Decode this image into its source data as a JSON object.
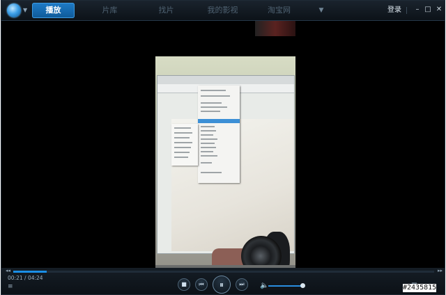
{
  "topbar": {
    "tabs": [
      {
        "label": "播放",
        "active": true
      },
      {
        "label": "片库",
        "active": false
      },
      {
        "label": "找片",
        "active": false
      },
      {
        "label": "我的影视",
        "active": false
      },
      {
        "label": "淘宝网",
        "active": false
      }
    ],
    "more_icon": "chevron-down-icon",
    "login_label": "登录",
    "window_buttons": {
      "minimize": "–",
      "maximize": "□",
      "close": "✕"
    }
  },
  "player": {
    "current_time": "00:21",
    "separator": "/",
    "total_time": "04:24",
    "progress": 0.08,
    "volume": 0.95,
    "icons": {
      "stop": "■",
      "prev": "⏮",
      "pause": "⏸",
      "next": "⏭",
      "volume": "🔈",
      "seek_back": "◂◂",
      "seek_forward": "▸▸",
      "playlist": "≡"
    },
    "accent_color": "#1a8ee6"
  },
  "watermark": "#2435815"
}
